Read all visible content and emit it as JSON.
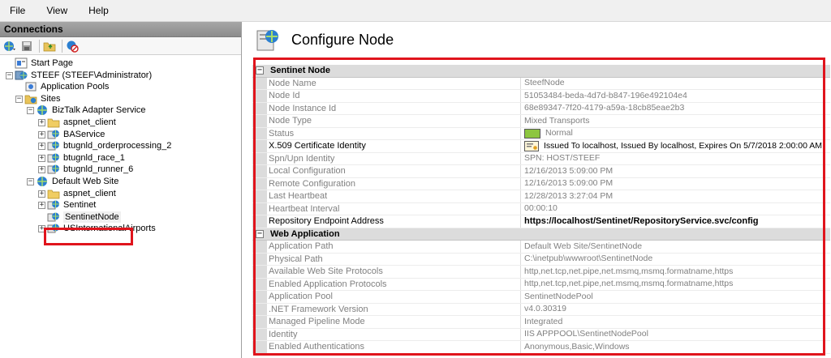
{
  "menu": {
    "file": "File",
    "view": "View",
    "help": "Help"
  },
  "left_panel": {
    "header": "Connections",
    "tree": [
      {
        "label": "Start Page",
        "level": 0,
        "icon": "start-page-icon",
        "expander": ""
      },
      {
        "label": "STEEF (STEEF\\Administrator)",
        "level": 0,
        "icon": "server-icon",
        "expander": "−"
      },
      {
        "label": "Application Pools",
        "level": 1,
        "icon": "app-pools-icon",
        "expander": ""
      },
      {
        "label": "Sites",
        "level": 1,
        "icon": "sites-folder-icon",
        "expander": "−"
      },
      {
        "label": "BizTalk Adapter Service",
        "level": 2,
        "icon": "globe-icon",
        "expander": "−"
      },
      {
        "label": "aspnet_client",
        "level": 3,
        "icon": "folder-icon",
        "expander": "+"
      },
      {
        "label": "BAService",
        "level": 3,
        "icon": "web-app-icon",
        "expander": "+"
      },
      {
        "label": "btugnld_orderprocessing_2",
        "level": 3,
        "icon": "web-app-icon",
        "expander": "+"
      },
      {
        "label": "btugnld_race_1",
        "level": 3,
        "icon": "web-app-icon",
        "expander": "+"
      },
      {
        "label": "btugnld_runner_6",
        "level": 3,
        "icon": "web-app-icon",
        "expander": "+"
      },
      {
        "label": "Default Web Site",
        "level": 2,
        "icon": "globe-icon",
        "expander": "−"
      },
      {
        "label": "aspnet_client",
        "level": 3,
        "icon": "folder-icon",
        "expander": "+"
      },
      {
        "label": "Sentinet",
        "level": 3,
        "icon": "web-app-icon",
        "expander": "+"
      },
      {
        "label": "SentinetNode",
        "level": 3,
        "icon": "web-app-icon",
        "expander": "",
        "selected": true
      },
      {
        "label": "USInternationalAirports",
        "level": 3,
        "icon": "web-app-icon",
        "expander": "+"
      }
    ]
  },
  "right_panel": {
    "title": "Configure Node",
    "sections": [
      {
        "name": "Sentinet Node",
        "props": [
          {
            "name": "Node Name",
            "value": "SteefNode"
          },
          {
            "name": "Node Id",
            "value": "51053484-beda-4d7d-b847-196e492104e4"
          },
          {
            "name": "Node Instance Id",
            "value": "68e89347-7f20-4179-a59a-18cb85eae2b3"
          },
          {
            "name": "Node Type",
            "value": "Mixed Transports"
          },
          {
            "name": "Status",
            "value": "Normal",
            "swatch": "#8dc63f"
          },
          {
            "name": "X.509 Certificate Identity",
            "value": "Issued To localhost, Issued By localhost, Expires On 5/7/2018 2:00:00 AM",
            "active": true,
            "cert": true
          },
          {
            "name": "Spn/Upn Identity",
            "value": "SPN: HOST/STEEF"
          },
          {
            "name": "Local Configuration",
            "value": "12/16/2013 5:09:00 PM"
          },
          {
            "name": "Remote Configuration",
            "value": "12/16/2013 5:09:00 PM"
          },
          {
            "name": "Last Heartbeat",
            "value": "12/28/2013 3:27:04 PM"
          },
          {
            "name": "Heartbeat Interval",
            "value": "00:00:10"
          },
          {
            "name": "Repository Endpoint Address",
            "value": "https://localhost/Sentinet/RepositoryService.svc/config",
            "active": true,
            "bold": true
          }
        ]
      },
      {
        "name": "Web Application",
        "props": [
          {
            "name": "Application Path",
            "value": "Default Web Site/SentinetNode"
          },
          {
            "name": "Physical Path",
            "value": "C:\\inetpub\\wwwroot\\SentinetNode"
          },
          {
            "name": "Available Web Site Protocols",
            "value": "http,net.tcp,net.pipe,net.msmq,msmq.formatname,https"
          },
          {
            "name": "Enabled Application Protocols",
            "value": "http,net.tcp,net.pipe,net.msmq,msmq.formatname,https"
          },
          {
            "name": "Application Pool",
            "value": "SentinetNodePool"
          },
          {
            "name": ".NET Framework Version",
            "value": "v4.0.30319"
          },
          {
            "name": "Managed Pipeline Mode",
            "value": "Integrated"
          },
          {
            "name": "Identity",
            "value": "IIS APPPOOL\\SentinetNodePool"
          },
          {
            "name": "Enabled Authentications",
            "value": "Anonymous,Basic,Windows"
          }
        ]
      }
    ]
  },
  "colors": {
    "highlight": "#e0141c",
    "status_normal": "#8dc63f"
  }
}
